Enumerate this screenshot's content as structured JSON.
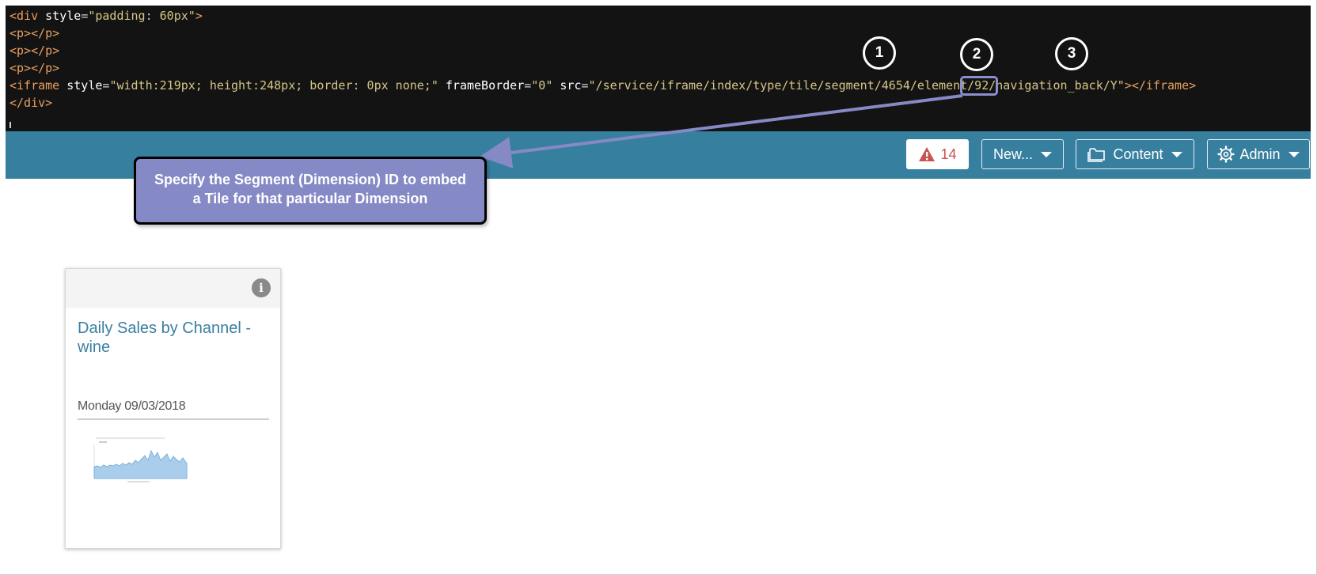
{
  "code": {
    "line1": {
      "open": "<div ",
      "attr": "style",
      "eq": "=",
      "value": "\"padding: 60px\"",
      "close": ">"
    },
    "p_open": "<p>",
    "p_close": "</p>",
    "iframe": {
      "open": "<iframe ",
      "attr1": "style",
      "val1": "\"width:219px; height:248px; border: 0px none;\"",
      "attr2": "frameBorder",
      "val2": "\"0\"",
      "attr3": "src",
      "val3": "\"/service/iframe/index/type/tile/segment/4654/element/92/navigation_back/Y\"",
      "gt": ">",
      "close": "</iframe>"
    },
    "div_close": "</div>"
  },
  "markers": {
    "m1": "1",
    "m2": "2",
    "m3": "3"
  },
  "toolbar": {
    "alert_count": "14",
    "new_label": "New...",
    "content_label": "Content",
    "admin_label": "Admin"
  },
  "callout": {
    "line1": "Specify the Segment (Dimension) ID to embed",
    "line2": "a Tile for that particular Dimension"
  },
  "tile": {
    "title_line1": "Daily Sales by Channel -",
    "title_line2": "wine",
    "date": "Monday 09/03/2018",
    "info_symbol": "i"
  },
  "colors": {
    "toolbar_bg": "#377f9f",
    "code_bg": "#131313",
    "callout_bg": "#8589c5",
    "alert_red": "#c9534f",
    "tile_title": "#3a7ea2"
  }
}
